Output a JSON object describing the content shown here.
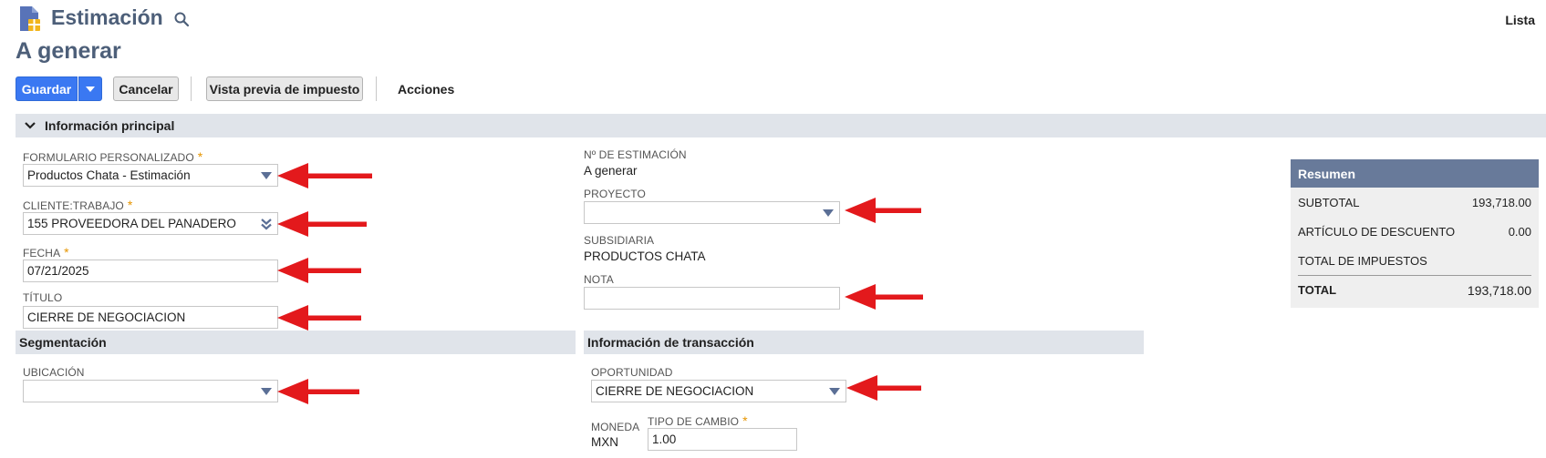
{
  "header": {
    "record_type": "Estimación",
    "list_link": "Lista",
    "page_title": "A generar"
  },
  "toolbar": {
    "save_label": "Guardar",
    "cancel_label": "Cancelar",
    "tax_preview_label": "Vista previa de impuesto",
    "actions_label": "Acciones"
  },
  "sections": {
    "main": "Información principal",
    "segmentation": "Segmentación",
    "transaction": "Información de transacción"
  },
  "fields": {
    "custom_form": {
      "label": "FORMULARIO PERSONALIZADO",
      "value": "Productos Chata - Estimación",
      "required": "*"
    },
    "customer_job": {
      "label": "CLIENTE:TRABAJO",
      "value": "155 PROVEEDORA DEL PANADERO",
      "required": "*"
    },
    "date": {
      "label": "FECHA",
      "value": "07/21/2025",
      "required": "*"
    },
    "title": {
      "label": "TÍTULO",
      "value": "CIERRE DE NEGOCIACION"
    },
    "estimate_no": {
      "label": "Nº DE ESTIMACIÓN",
      "value": "A generar"
    },
    "project": {
      "label": "PROYECTO",
      "value": ""
    },
    "subsidiary": {
      "label": "SUBSIDIARIA",
      "value": "PRODUCTOS CHATA"
    },
    "note": {
      "label": "NOTA",
      "value": ""
    },
    "location": {
      "label": "UBICACIÓN",
      "value": ""
    },
    "opportunity": {
      "label": "OPORTUNIDAD",
      "value": "CIERRE DE NEGOCIACION"
    },
    "currency": {
      "label": "MONEDA",
      "value": "MXN"
    },
    "exchange_rate": {
      "label": "TIPO DE CAMBIO",
      "value": "1.00",
      "required": "*"
    }
  },
  "summary": {
    "title": "Resumen",
    "rows": [
      {
        "label": "SUBTOTAL",
        "value": "193,718.00"
      },
      {
        "label": "ARTÍCULO DE DESCUENTO",
        "value": "0.00"
      },
      {
        "label": "TOTAL DE IMPUESTOS",
        "value": ""
      },
      {
        "label": "TOTAL",
        "value": "193,718.00"
      }
    ]
  },
  "colors": {
    "accent_blue": "#3a78f2",
    "title_slate": "#4d5f79",
    "summary_header": "#687a9a",
    "annotation_red": "#e3191c",
    "required_orange": "#e69500"
  },
  "icons": [
    "record-icon",
    "search-icon",
    "chevron-down-icon",
    "dropdown-caret-icon",
    "double-chevron-icon",
    "red-arrow-annotation"
  ]
}
